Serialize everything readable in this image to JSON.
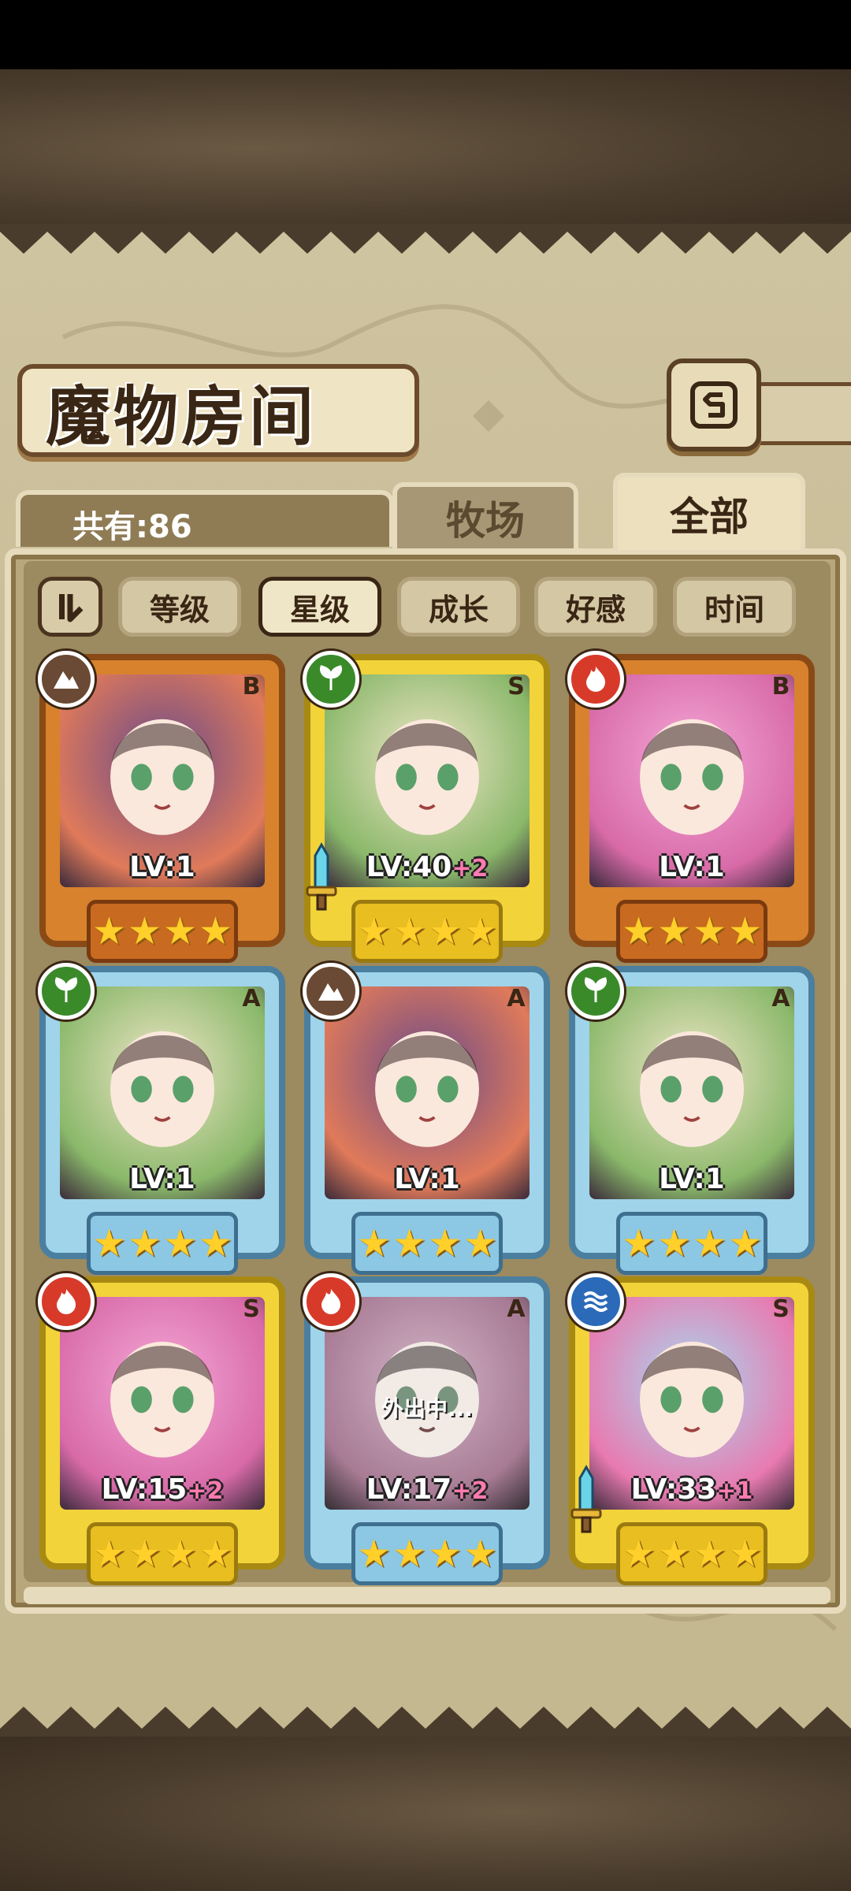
{
  "title": "魔物房间",
  "count_label": "共有:86",
  "tabs": {
    "ranch": "牧场",
    "all": "全部"
  },
  "filters": [
    "等级",
    "星级",
    "成长",
    "好感",
    "时间"
  ],
  "active_filter": "星级",
  "colors": {
    "fire": "#d83a2a",
    "earth": "#6a4a34",
    "nature": "#3a8a2a",
    "water": "#2a6ab8"
  },
  "cards": [
    {
      "element": "earth",
      "rank": "B",
      "level": "LV:1",
      "plus": "",
      "stars": 4,
      "weapon": false,
      "status": ""
    },
    {
      "element": "nature",
      "rank": "S",
      "level": "LV:40",
      "plus": "+2",
      "stars": 4,
      "weapon": true,
      "status": ""
    },
    {
      "element": "fire",
      "rank": "B",
      "level": "LV:1",
      "plus": "",
      "stars": 4,
      "weapon": false,
      "status": ""
    },
    {
      "element": "nature",
      "rank": "A",
      "level": "LV:1",
      "plus": "",
      "stars": 4,
      "weapon": false,
      "status": ""
    },
    {
      "element": "earth",
      "rank": "A",
      "level": "LV:1",
      "plus": "",
      "stars": 4,
      "weapon": false,
      "status": ""
    },
    {
      "element": "nature",
      "rank": "A",
      "level": "LV:1",
      "plus": "",
      "stars": 4,
      "weapon": false,
      "status": ""
    },
    {
      "element": "fire",
      "rank": "S",
      "level": "LV:15",
      "plus": "+2",
      "stars": 4,
      "weapon": false,
      "status": ""
    },
    {
      "element": "fire",
      "rank": "A",
      "level": "LV:17",
      "plus": "+2",
      "stars": 4,
      "weapon": false,
      "status": "外出中..."
    },
    {
      "element": "water",
      "rank": "S",
      "level": "LV:33",
      "plus": "+1",
      "stars": 4,
      "weapon": true,
      "status": ""
    }
  ]
}
